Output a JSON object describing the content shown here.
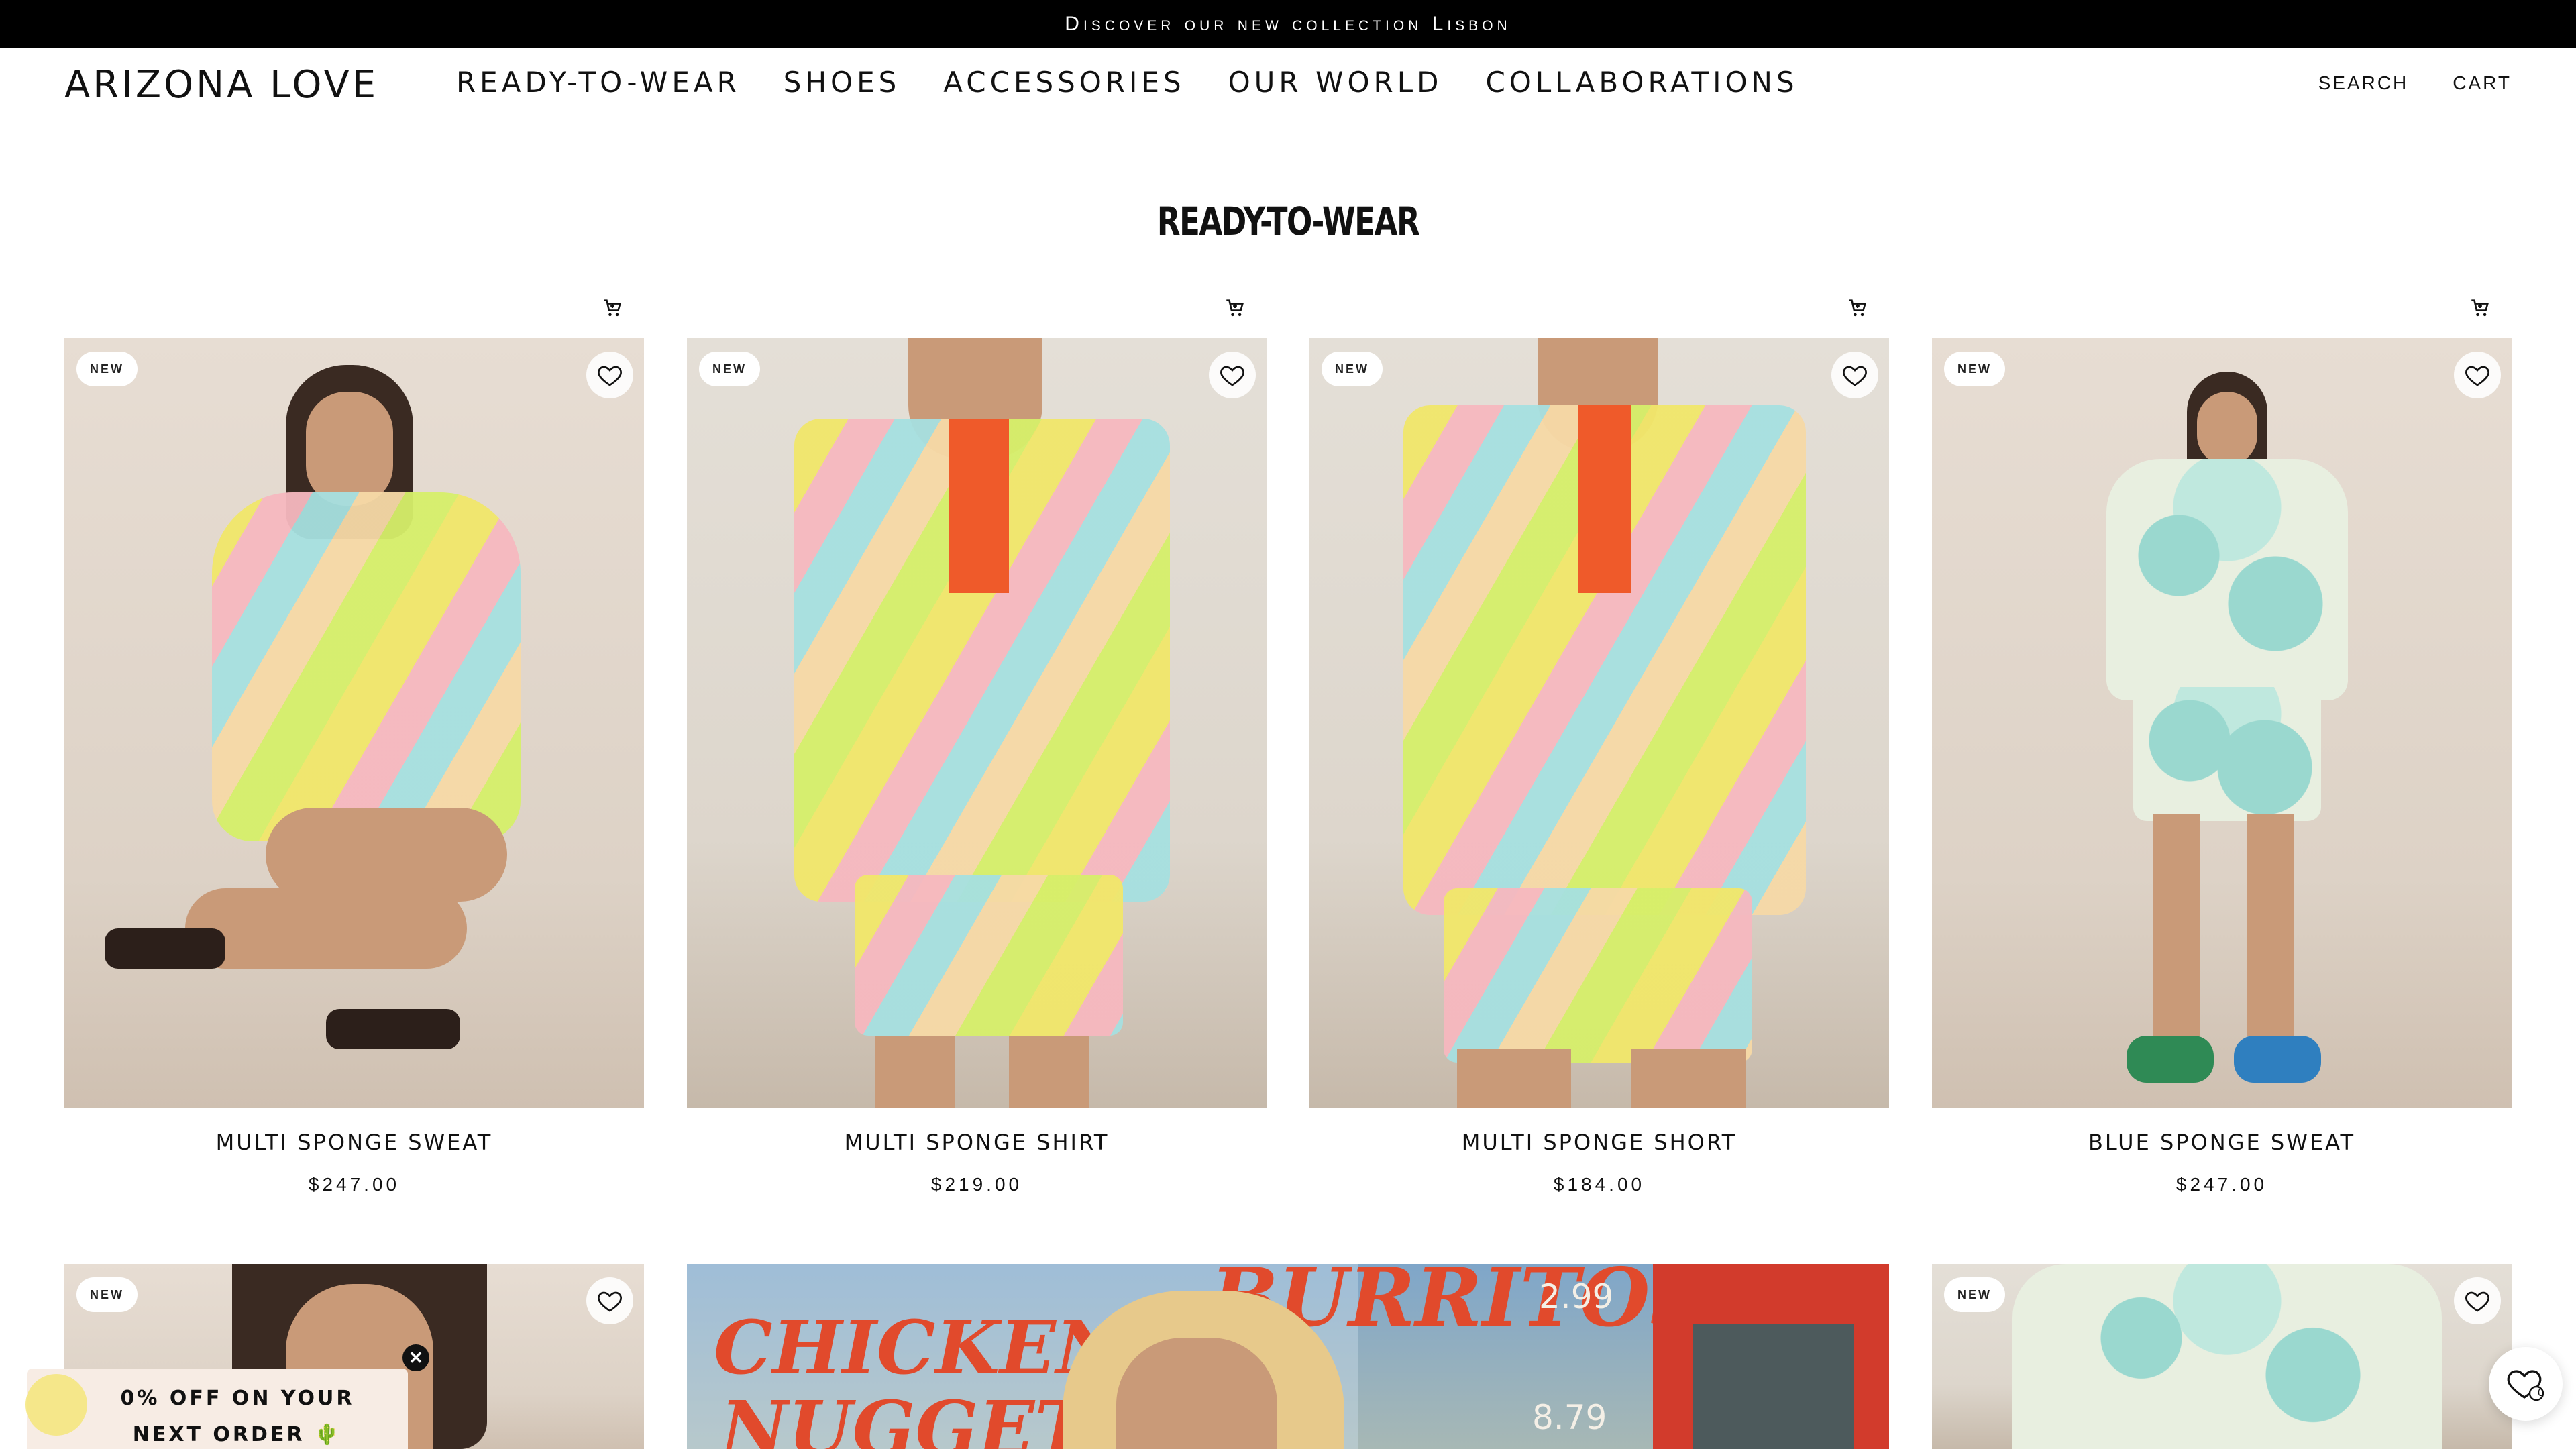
{
  "announcement": {
    "text": "Discover our new collection Lisbon"
  },
  "header": {
    "logo": "ARIZONA LOVE",
    "nav": [
      "READY-TO-WEAR",
      "SHOES",
      "ACCESSORIES",
      "OUR WORLD",
      "COLLABORATIONS"
    ],
    "search_label": "SEARCH",
    "cart_label": "CART"
  },
  "page": {
    "title": "READY-TO-WEAR"
  },
  "products": [
    {
      "badge": "NEW",
      "name": "MULTI SPONGE SWEAT",
      "price": "$247.00",
      "icons": [
        "heart-icon",
        "cart-icon"
      ]
    },
    {
      "badge": "NEW",
      "name": "MULTI SPONGE SHIRT",
      "price": "$219.00",
      "icons": [
        "heart-icon",
        "cart-icon"
      ]
    },
    {
      "badge": "NEW",
      "name": "MULTI SPONGE SHORT",
      "price": "$184.00",
      "icons": [
        "heart-icon",
        "cart-icon"
      ]
    },
    {
      "badge": "NEW",
      "name": "BLUE SPONGE SWEAT",
      "price": "$247.00",
      "icons": [
        "heart-icon",
        "cart-icon"
      ]
    }
  ],
  "second_row": {
    "left_badge": "NEW",
    "right_badge": "NEW",
    "banner_sign_words": [
      "CHICKEN",
      "NUGGETS",
      "BURRITOS",
      "2.99",
      "8.79"
    ]
  },
  "promo": {
    "text": "0% OFF ON YOUR NEXT ORDER 🌵"
  },
  "wishlist_count": "0",
  "colors": {
    "announcement_bg": "#000000",
    "promo_bg": "#f7ece4",
    "text": "#111111"
  }
}
